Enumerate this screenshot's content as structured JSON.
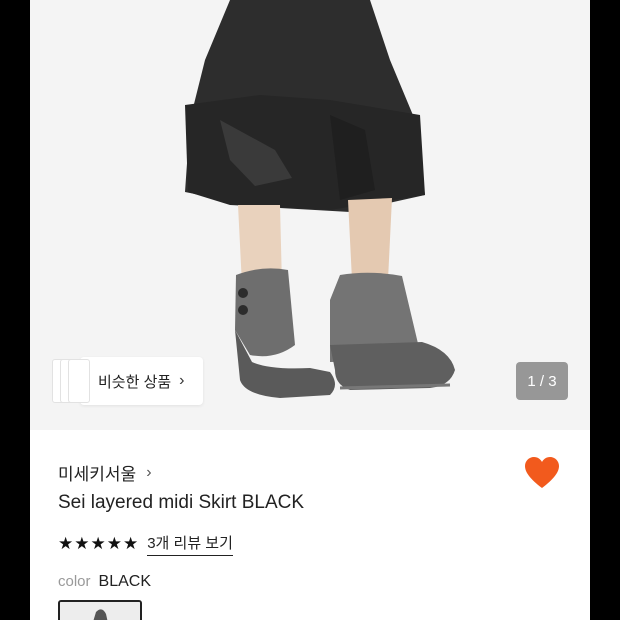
{
  "colors": {
    "heart": "#f25a1d",
    "skirt": "#2b2b2b",
    "boots": "#6f6f6f"
  },
  "gallery": {
    "similar_label": "비슷한 상품",
    "similar_chevron": "›",
    "indicator": "1 / 3"
  },
  "product": {
    "brand": "미세키서울",
    "brand_chevron": "›",
    "title": "Sei layered midi Skirt BLACK",
    "stars": "★★★★★",
    "review_link": "3개 리뷰 보기",
    "color_label": "color",
    "color_value": "BLACK",
    "favorite_icon": "heart-icon"
  }
}
